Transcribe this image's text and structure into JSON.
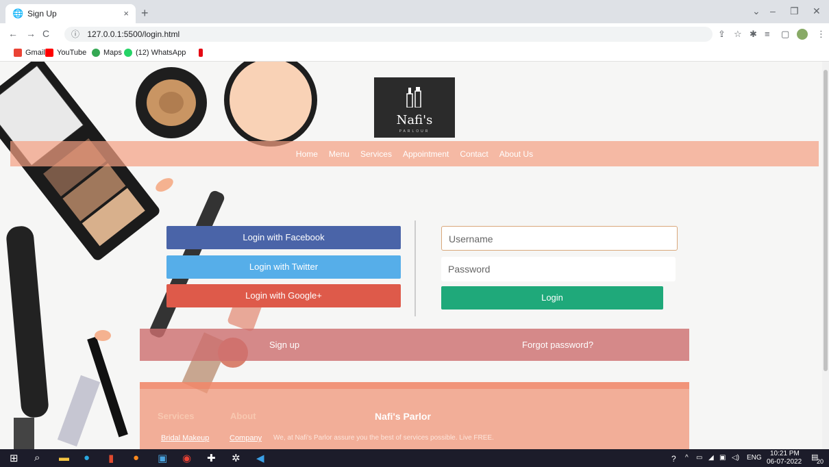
{
  "browser": {
    "tab_title": "Sign Up",
    "tab_close": "×",
    "new_tab": "+",
    "url": "127.0.0.1:5500/login.html",
    "win_min": "–",
    "win_max": "❐",
    "win_close": "✕",
    "win_drop": "⌄"
  },
  "bookmarks": [
    {
      "label": "Gmail",
      "color": "#ea4335"
    },
    {
      "label": "YouTube",
      "color": "#ff0000"
    },
    {
      "label": "Maps",
      "color": "#34a853"
    },
    {
      "label": "(12) WhatsApp",
      "color": "#25d366"
    },
    {
      "label": "",
      "color": "#e50914"
    }
  ],
  "logo": {
    "name": "Nafi's",
    "sub": "PARLOUR"
  },
  "nav": [
    "Home",
    "Menu",
    "Services",
    "Appointment",
    "Contact",
    "About Us"
  ],
  "social": {
    "facebook": "Login with Facebook",
    "twitter": "Login with Twitter",
    "google": "Login with Google+"
  },
  "form": {
    "username_placeholder": "Username",
    "password_placeholder": "Password",
    "login_label": "Login"
  },
  "links": {
    "signup": "Sign up",
    "forgot": "Forgot password?"
  },
  "footer": {
    "services_title": "Services",
    "about_title": "About",
    "brand": "Nafi's Parlor",
    "services_link": "Bridal Makeup",
    "about_link": "Company",
    "desc": "We, at Nafi's Parlor assure you the best of services possible. Live FREE."
  },
  "tray": {
    "lang": "ENG",
    "time": "10:21 PM",
    "date": "06-07-2022",
    "badge": "20"
  },
  "colors": {
    "facebook": "#4a64a8",
    "twitter": "#56aee9",
    "google": "#de5a4a",
    "login": "#1fa97a"
  }
}
